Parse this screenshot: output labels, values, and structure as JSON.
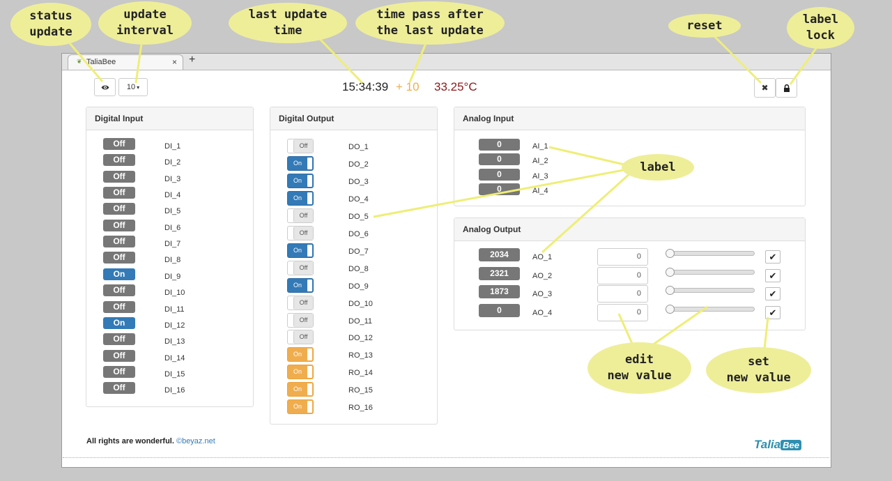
{
  "browser": {
    "tab_title": "TaliaBee",
    "tab_close": "×",
    "new_tab": "+"
  },
  "toolbar": {
    "interval_value": "10",
    "interval_caret": "▾",
    "time": "15:34:39",
    "elapsed": "+ 10",
    "temperature": "33.25°C",
    "reset_icon": "✖",
    "lock_icon": "🔒"
  },
  "digital_input": {
    "title": "Digital Input",
    "items": [
      {
        "state": "Off",
        "label": "DI_1"
      },
      {
        "state": "Off",
        "label": "DI_2"
      },
      {
        "state": "Off",
        "label": "DI_3"
      },
      {
        "state": "Off",
        "label": "DI_4"
      },
      {
        "state": "Off",
        "label": "DI_5"
      },
      {
        "state": "Off",
        "label": "DI_6"
      },
      {
        "state": "Off",
        "label": "DI_7"
      },
      {
        "state": "Off",
        "label": "DI_8"
      },
      {
        "state": "On",
        "label": "DI_9"
      },
      {
        "state": "Off",
        "label": "DI_10"
      },
      {
        "state": "Off",
        "label": "DI_11"
      },
      {
        "state": "On",
        "label": "DI_12"
      },
      {
        "state": "Off",
        "label": "DI_13"
      },
      {
        "state": "Off",
        "label": "DI_14"
      },
      {
        "state": "Off",
        "label": "DI_15"
      },
      {
        "state": "Off",
        "label": "DI_16"
      }
    ]
  },
  "digital_output": {
    "title": "Digital Output",
    "items": [
      {
        "state": "Off",
        "label": "DO_1",
        "kind": "off"
      },
      {
        "state": "On",
        "label": "DO_2",
        "kind": "on"
      },
      {
        "state": "On",
        "label": "DO_3",
        "kind": "on"
      },
      {
        "state": "On",
        "label": "DO_4",
        "kind": "on"
      },
      {
        "state": "Off",
        "label": "DO_5",
        "kind": "off"
      },
      {
        "state": "Off",
        "label": "DO_6",
        "kind": "off"
      },
      {
        "state": "On",
        "label": "DO_7",
        "kind": "on"
      },
      {
        "state": "Off",
        "label": "DO_8",
        "kind": "off"
      },
      {
        "state": "On",
        "label": "DO_9",
        "kind": "on"
      },
      {
        "state": "Off",
        "label": "DO_10",
        "kind": "off"
      },
      {
        "state": "Off",
        "label": "DO_11",
        "kind": "off"
      },
      {
        "state": "Off",
        "label": "DO_12",
        "kind": "off"
      },
      {
        "state": "On",
        "label": "RO_13",
        "kind": "ro"
      },
      {
        "state": "On",
        "label": "RO_14",
        "kind": "ro"
      },
      {
        "state": "On",
        "label": "RO_15",
        "kind": "ro"
      },
      {
        "state": "On",
        "label": "RO_16",
        "kind": "ro"
      }
    ]
  },
  "analog_input": {
    "title": "Analog Input",
    "items": [
      {
        "value": "0",
        "label": "AI_1"
      },
      {
        "value": "0",
        "label": "AI_2"
      },
      {
        "value": "0",
        "label": "AI_3"
      },
      {
        "value": "0",
        "label": "AI_4"
      }
    ]
  },
  "analog_output": {
    "title": "Analog Output",
    "set_icon": "✔",
    "items": [
      {
        "value": "2034",
        "label": "AO_1",
        "input": "0",
        "slider_level": 0
      },
      {
        "value": "2321",
        "label": "AO_2",
        "input": "0",
        "slider_level": 0
      },
      {
        "value": "1873",
        "label": "AO_3",
        "input": "0",
        "slider_level": 0
      },
      {
        "value": "0",
        "label": "AO_4",
        "input": "0",
        "slider_level": 0
      }
    ]
  },
  "footer": {
    "text": "All rights are wonderful.",
    "link": "©beyaz.net"
  },
  "logo": {
    "talia": "Talia",
    "bee": "Bee"
  },
  "callouts": {
    "status_update": "status\nupdate",
    "update_interval": "update\ninterval",
    "last_update_time": "last update\ntime",
    "time_pass": "time pass after\nthe last update",
    "reset": "reset",
    "label_lock": "label\nlock",
    "label": "label",
    "edit_new_value": "edit\nnew value",
    "set_new_value": "set\nnew value"
  },
  "colors": {
    "on": "#337ab7",
    "off": "#777777",
    "relay": "#f0ad4e",
    "callout": "#eeee99",
    "elapsed": "#f0ad4e",
    "temperature": "#8b1a1a"
  }
}
